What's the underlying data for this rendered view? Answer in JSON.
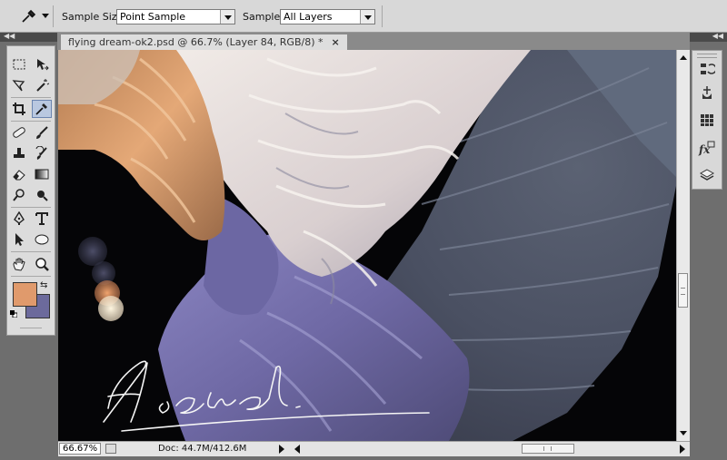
{
  "options_bar": {
    "tool_icon": "eyedropper-icon",
    "sample_size_label": "Sample Size:",
    "sample_size_value": "Point Sample",
    "sample_label": "Sample:",
    "sample_value": "All Layers"
  },
  "document": {
    "tab_title": "flying dream-ok2.psd @ 66.7% (Layer 84, RGB/8) *",
    "close_glyph": "×"
  },
  "tools": [
    "rectangular-marquee-icon",
    "move-icon",
    "lasso-icon",
    "magic-wand-icon",
    "crop-icon",
    "eyedropper-icon",
    "healing-brush-icon",
    "brush-icon",
    "clone-stamp-icon",
    "history-brush-icon",
    "eraser-icon",
    "gradient-icon",
    "dodge-icon",
    "blur-icon",
    "pen-icon",
    "type-icon",
    "path-selection-icon",
    "ellipse-shape-icon",
    "hand-icon",
    "zoom-icon"
  ],
  "colors": {
    "foreground": "#e09a6c",
    "background": "#6c6a9c",
    "selected_tool": "#b9c8e0"
  },
  "status": {
    "zoom": "66.67%",
    "doc_info": "Doc: 44.7M/412.6M"
  },
  "dock_icons": [
    "history-icon",
    "actions-icon",
    "swatches-icon",
    "styles-fx-icon",
    "layers-icon"
  ],
  "artwork": {
    "signature": "signature"
  }
}
